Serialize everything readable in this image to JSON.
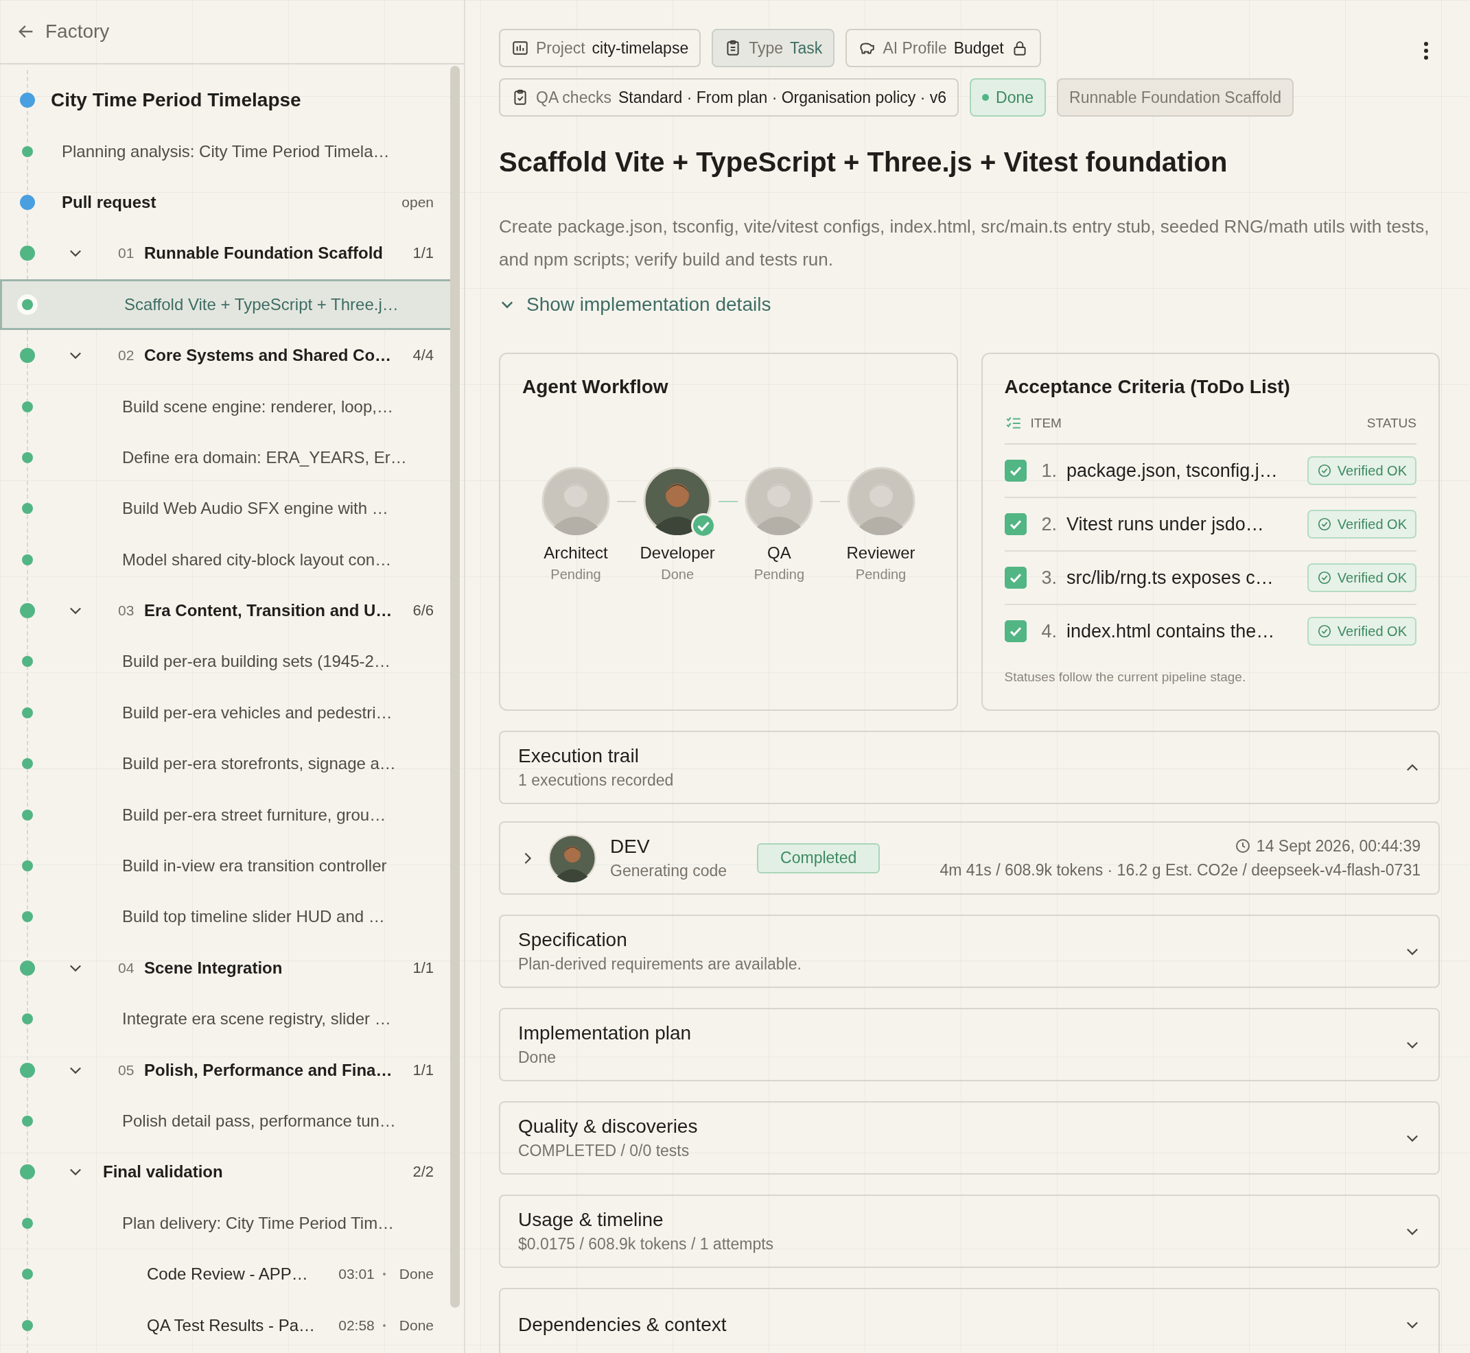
{
  "sidebar": {
    "back_link": "Factory",
    "tree": [
      {
        "kind": "project",
        "label": "City Time Period Timelapse",
        "color": "#4a9fe0",
        "selected": false
      },
      {
        "kind": "task",
        "label": "Planning analysis: City Time Period Timela…",
        "color": "#52b584",
        "selected": false
      },
      {
        "kind": "pull_request",
        "label": "Pull request",
        "status": "open",
        "color": "#4a9fe0",
        "selected": false
      },
      {
        "kind": "phase",
        "number": "01",
        "label": "Runnable Foundation Scaffold",
        "count": "1/1",
        "expanded": true,
        "color": "#52b584",
        "selected": false,
        "children": [
          {
            "kind": "task",
            "label": "Scaffold Vite + TypeScript + Three.j…",
            "color": "#52b584",
            "selected": true
          }
        ]
      },
      {
        "kind": "phase",
        "number": "02",
        "label": "Core Systems and Shared Co…",
        "count": "4/4",
        "expanded": true,
        "color": "#52b584",
        "selected": false,
        "children": [
          {
            "kind": "task",
            "label": "Build scene engine: renderer, loop,…",
            "color": "#52b584",
            "selected": false
          },
          {
            "kind": "task",
            "label": "Define era domain: ERA_YEARS, Er…",
            "color": "#52b584",
            "selected": false
          },
          {
            "kind": "task",
            "label": "Build Web Audio SFX engine with …",
            "color": "#52b584",
            "selected": false
          },
          {
            "kind": "task",
            "label": "Model shared city-block layout con…",
            "color": "#52b584",
            "selected": false
          }
        ]
      },
      {
        "kind": "phase",
        "number": "03",
        "label": "Era Content, Transition and U…",
        "count": "6/6",
        "expanded": true,
        "color": "#52b584",
        "selected": false,
        "children": [
          {
            "kind": "task",
            "label": "Build per-era building sets (1945-2…",
            "color": "#52b584",
            "selected": false
          },
          {
            "kind": "task",
            "label": "Build per-era vehicles and pedestri…",
            "color": "#52b584",
            "selected": false
          },
          {
            "kind": "task",
            "label": "Build per-era storefronts, signage a…",
            "color": "#52b584",
            "selected": false
          },
          {
            "kind": "task",
            "label": "Build per-era street furniture, grou…",
            "color": "#52b584",
            "selected": false
          },
          {
            "kind": "task",
            "label": "Build in-view era transition controller",
            "color": "#52b584",
            "selected": false
          },
          {
            "kind": "task",
            "label": "Build top timeline slider HUD and …",
            "color": "#52b584",
            "selected": false
          }
        ]
      },
      {
        "kind": "phase",
        "number": "04",
        "label": "Scene Integration",
        "count": "1/1",
        "expanded": true,
        "color": "#52b584",
        "selected": false,
        "children": [
          {
            "kind": "task",
            "label": "Integrate era scene registry, slider …",
            "color": "#52b584",
            "selected": false
          }
        ]
      },
      {
        "kind": "phase",
        "number": "05",
        "label": "Polish, Performance and Fina…",
        "count": "1/1",
        "expanded": true,
        "color": "#52b584",
        "selected": false,
        "children": [
          {
            "kind": "task",
            "label": "Polish detail pass, performance tun…",
            "color": "#52b584",
            "selected": false
          }
        ]
      },
      {
        "kind": "phase",
        "label": "Final validation",
        "count": "2/2",
        "expanded": true,
        "color": "#52b584",
        "selected": false,
        "children": [
          {
            "kind": "task",
            "label": "Plan delivery: City Time Period Tim…",
            "color": "#52b584",
            "selected": false,
            "children": [
              {
                "kind": "report",
                "label": "Code Review - APP…",
                "time": "03:01",
                "status": "Done",
                "color": "#52b584",
                "selected": false
              },
              {
                "kind": "report",
                "label": "QA Test Results - Pa…",
                "time": "02:58",
                "status": "Done",
                "color": "#52b584",
                "selected": false
              }
            ]
          }
        ]
      }
    ]
  },
  "chip_rows": [
    [
      {
        "kind": "project",
        "label": "Project",
        "value": "city-timelapse"
      },
      {
        "kind": "type",
        "label": "Type",
        "value": "Task"
      },
      {
        "kind": "profile",
        "label": "AI Profile",
        "value": "Budget",
        "locked": true
      }
    ],
    [
      {
        "kind": "qa",
        "label": "QA checks",
        "value": "Standard · From plan · Organisation policy · v6"
      },
      {
        "kind": "status",
        "value": "Done"
      },
      {
        "kind": "phase",
        "value": "Runnable Foundation Scaffold"
      }
    ]
  ],
  "title": "Scaffold Vite + TypeScript + Three.js + Vitest foundation",
  "description": "Create package.json, tsconfig, vite/vitest configs, index.html, src/main.ts entry stub, seeded RNG/math utils with tests, and npm scripts; verify build and tests run.",
  "details_toggle": {
    "label": "Show implementation details",
    "expanded": false
  },
  "agent_workflow": {
    "title": "Agent Workflow",
    "agents": [
      {
        "name": "Architect",
        "status": "Pending",
        "done": false
      },
      {
        "name": "Developer",
        "status": "Done",
        "done": true
      },
      {
        "name": "QA",
        "status": "Pending",
        "done": false
      },
      {
        "name": "Reviewer",
        "status": "Pending",
        "done": false
      }
    ]
  },
  "acceptance": {
    "title": "Acceptance Criteria (ToDo List)",
    "columns": [
      "ITEM",
      "STATUS"
    ],
    "items": [
      {
        "number": "1.",
        "text": "package.json, tsconfig.j…",
        "checked": true,
        "status": "Verified OK"
      },
      {
        "number": "2.",
        "text": "Vitest runs under jsdo…",
        "checked": true,
        "status": "Verified OK"
      },
      {
        "number": "3.",
        "text": "src/lib/rng.ts exposes c…",
        "checked": true,
        "status": "Verified OK"
      },
      {
        "number": "4.",
        "text": "index.html contains the…",
        "checked": true,
        "status": "Verified OK"
      }
    ],
    "footnote": "Statuses follow the current pipeline stage."
  },
  "execution_trail": {
    "title": "Execution trail",
    "subtitle": "1 executions recorded",
    "expanded": true,
    "executions": [
      {
        "agent": "DEV",
        "activity": "Generating code",
        "status": "Completed",
        "timestamp": "14 Sept 2026, 00:44:39",
        "metrics": "4m 41s / 608.9k tokens · 16.2 g Est. CO2e / deepseek-v4-flash-0731",
        "expanded": false
      }
    ]
  },
  "sections": [
    {
      "title": "Specification",
      "subtitle": "Plan-derived requirements are available.",
      "expanded": false
    },
    {
      "title": "Implementation plan",
      "subtitle": "Done",
      "expanded": false
    },
    {
      "title": "Quality & discoveries",
      "subtitle": "COMPLETED / 0/0 tests",
      "expanded": false
    },
    {
      "title": "Usage & timeline",
      "subtitle": "$0.0175 / 608.9k tokens / 1 attempts",
      "expanded": false
    },
    {
      "title": "Dependencies & context",
      "expanded": false
    }
  ]
}
